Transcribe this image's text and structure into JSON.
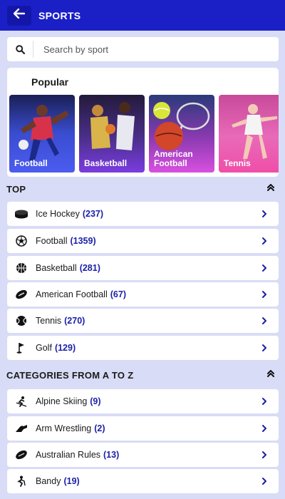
{
  "header": {
    "title": "SPORTS",
    "back_icon": "arrow-left-icon"
  },
  "search": {
    "placeholder": "Search by sport",
    "icon": "search-icon"
  },
  "popular": {
    "title": "Popular",
    "cards": [
      {
        "label": "Football",
        "color": "#3b4fd6"
      },
      {
        "label": "Basketball",
        "color": "#6a2bd4"
      },
      {
        "label": "American Football",
        "color": "#c43fd6"
      },
      {
        "label": "Tennis",
        "color": "#e84aa3"
      }
    ]
  },
  "sections": [
    {
      "title": "TOP",
      "items": [
        {
          "name": "Ice Hockey",
          "count": "(237)",
          "icon": "ice-hockey-puck-icon"
        },
        {
          "name": "Football",
          "count": "(1359)",
          "icon": "soccer-ball-icon"
        },
        {
          "name": "Basketball",
          "count": "(281)",
          "icon": "basketball-icon"
        },
        {
          "name": "American Football",
          "count": "(67)",
          "icon": "american-football-icon"
        },
        {
          "name": "Tennis",
          "count": "(270)",
          "icon": "tennis-ball-icon"
        },
        {
          "name": "Golf",
          "count": "(129)",
          "icon": "golf-flag-icon"
        }
      ]
    },
    {
      "title": "CATEGORIES FROM A TO Z",
      "items": [
        {
          "name": "Alpine Skiing",
          "count": "(9)",
          "icon": "skiing-icon"
        },
        {
          "name": "Arm Wrestling",
          "count": "(2)",
          "icon": "arm-wrestling-icon"
        },
        {
          "name": "Australian Rules",
          "count": "(13)",
          "icon": "australian-rules-ball-icon"
        },
        {
          "name": "Bandy",
          "count": "(19)",
          "icon": "bandy-player-icon"
        }
      ]
    }
  ],
  "colors": {
    "header_bg": "#1b1fc6",
    "accent": "#1b1fa8",
    "page_bg": "#d9dcf6"
  }
}
